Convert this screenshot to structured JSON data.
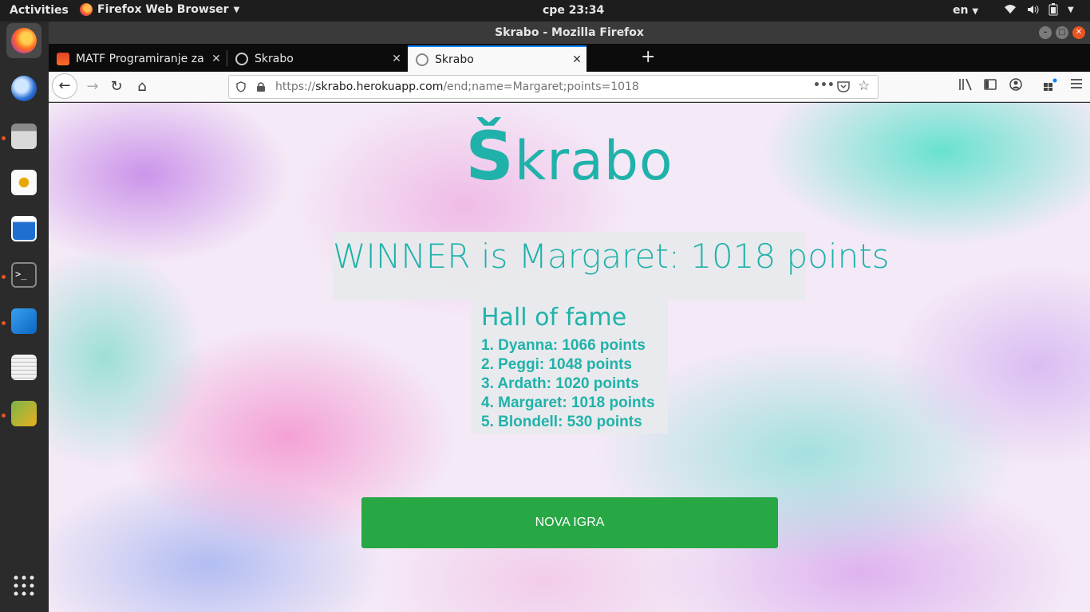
{
  "topbar": {
    "activities": "Activities",
    "app_name": "Firefox Web Browser",
    "clock": "cpe 23:34",
    "lang": "en"
  },
  "dock": {
    "apps": [
      "Firefox",
      "Thunderbird",
      "Files",
      "Rhythmbox",
      "LibreOffice Writer",
      "Terminal",
      "Visual Studio Code",
      "Text Editor",
      "Image Viewer",
      "Show Applications"
    ]
  },
  "window": {
    "title": "Skrabo - Mozilla Firefox"
  },
  "tabs": [
    {
      "label": "MATF Programiranje za v",
      "active": false
    },
    {
      "label": "Skrabo",
      "active": false
    },
    {
      "label": "Skrabo",
      "active": true
    }
  ],
  "navbar": {
    "url_prefix": "https://",
    "url_host": "skrabo.herokuapp.com",
    "url_path": "/end;name=Margaret;points=1018"
  },
  "page": {
    "logo_first": "Š",
    "logo_rest": "krabo",
    "winner_text": "WINNER is Margaret: 1018 points",
    "hall_of_fame_title": "Hall of fame",
    "hall_of_fame": [
      "1. Dyanna: 1066 points",
      "2. Peggi: 1048 points",
      "3. Ardath: 1020 points",
      "4. Margaret: 1018 points",
      "5. Blondell: 530 points"
    ],
    "button_label": "NOVA IGRA"
  },
  "colors": {
    "accent": "#20b2aa",
    "button": "#28a745",
    "ubuntu_orange": "#e95420",
    "firefox_blue": "#0a84ff"
  }
}
